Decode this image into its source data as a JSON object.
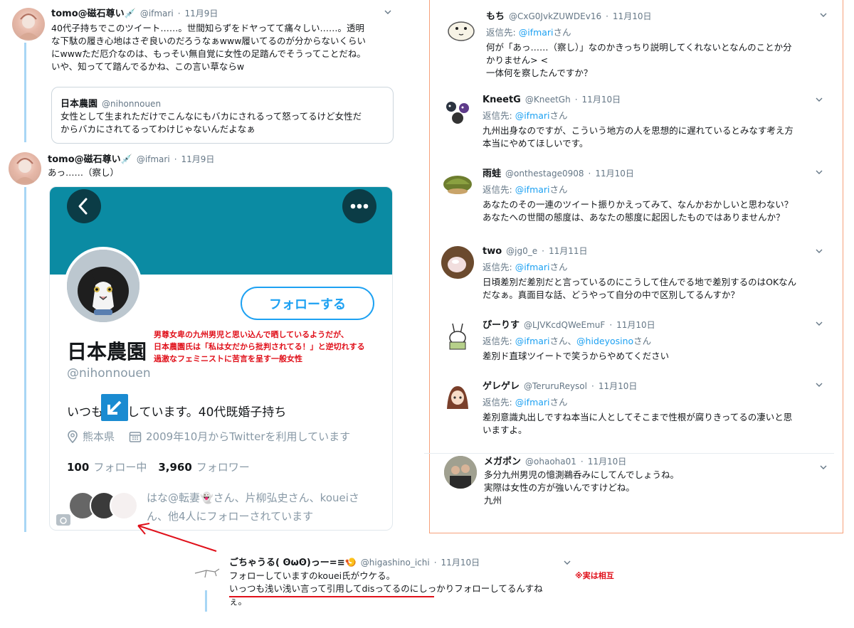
{
  "left_tweets": [
    {
      "name": "tomo@磁石尊い💉",
      "handle": "@ifmari",
      "date": "11月9日",
      "lines": [
        "40代子持ちでこのツイート……。世間知らずをドヤってて痛々しい……。透明",
        "な下駄の履き心地はさぞ良いのだろうなぁwww履いてるのが分からないくらい",
        "にwwwただ厄介なのは、もっそい無自覚に女性の足踏んでそうってことだね。",
        "いや、知ってて踏んでるかね、この言い草ならw"
      ],
      "quote": {
        "name": "日本農園",
        "handle": "@nihonnouen",
        "lines": [
          "女性として生まれただけでこんなにもバカにされるって怒ってるけど女性だ",
          "からバカにされてるってわけじゃないんだよなぁ"
        ]
      }
    },
    {
      "name": "tomo@磁石尊い💉",
      "handle": "@ifmari",
      "date": "11月9日",
      "text": "あっ……（察し）"
    }
  ],
  "profile_card": {
    "follow_button": "フォローする",
    "display_name": "日本農園",
    "handle": "@nihonnouen",
    "bio": "いつも感謝しています。40代既婚子持ち",
    "location": "熊本県",
    "joined": "2009年10月からTwitterを利用しています",
    "following_count": "100",
    "following_label": "フォロー中",
    "followers_count": "3,960",
    "followers_label": "フォロワー",
    "followed_by_line1": "はな@転妻👻さん、片柳弘史さん、koueiさ",
    "followed_by_line2": "ん、他4人にフォローされています",
    "back_icon": "chevron-left-icon",
    "more_icon": "more-icon",
    "banner_color": "#0b8ba3",
    "follow_color": "#1da1f2"
  },
  "annotation_red": {
    "lines": [
      "男尊女卑の九州男児と思い込んで晒しているようだが、",
      "日本農園氏は「私は女だから批判されてる！」と逆切れする",
      "過激なフェミニストに苦言を呈す一般女性"
    ],
    "color": "#e0101a"
  },
  "replies": [
    {
      "name": "もち",
      "handle": "@CxG0JvkZUWDEv16",
      "date": "11月10日",
      "reply_prefix": "返信先:",
      "reply_links": [
        "@ifmari"
      ],
      "reply_suffix": "さん",
      "lines": [
        "何が「あっ……（察し）」なのかきっちり説明してくれないとなんのことか分",
        "かりません> <",
        "一体何を察したんですか？"
      ]
    },
    {
      "name": "KneetG",
      "handle": "@KneetGh",
      "date": "11月10日",
      "reply_prefix": "返信先:",
      "reply_links": [
        "@ifmari"
      ],
      "reply_suffix": "さん",
      "lines": [
        "九州出身なのですが、こういう地方の人を思想的に遅れているとみなす考え方",
        "本当にやめてほしいです。"
      ]
    },
    {
      "name": "雨蛙",
      "handle": "@onthestage0908",
      "date": "11月10日",
      "reply_prefix": "返信先:",
      "reply_links": [
        "@ifmari"
      ],
      "reply_suffix": "さん",
      "lines": [
        "あなたのその一連のツイート振りかえってみて、なんかおかしいと思わない？",
        "あなたへの世間の態度は、あなたの態度に起因したものではありませんか？"
      ]
    },
    {
      "name": "two",
      "handle": "@jg0_e",
      "date": "11月11日",
      "reply_prefix": "返信先:",
      "reply_links": [
        "@ifmari"
      ],
      "reply_suffix": "さん",
      "lines": [
        "日頃差別だ差別だと言っているのにこうして住んでる地で差別するのはOKなん",
        "だなぁ。真面目な話、どうやって自分の中で区別してるんすか？"
      ]
    },
    {
      "name": "ぴーりす",
      "handle": "@LJVKcdQWeEmuF",
      "date": "11月10日",
      "reply_prefix": "返信先:",
      "reply_links": [
        "@ifmari",
        "@hideyosino"
      ],
      "reply_mid": "さん、",
      "reply_suffix": "さん",
      "lines": [
        "差別ド直球ツイートで笑うからやめてください"
      ]
    },
    {
      "name": "ゲレゲレ",
      "handle": "@TeruruReysol",
      "date": "11月10日",
      "reply_prefix": "返信先:",
      "reply_links": [
        "@ifmari"
      ],
      "reply_suffix": "さん",
      "lines": [
        "差別意識丸出しですね本当に人としてそこまで性根が腐りきってるの凄いと思",
        "いますよ。"
      ]
    },
    {
      "name": "メガポン",
      "handle": "@ohaoha01",
      "date": "11月10日",
      "lines": [
        "多分九州男児の憶測鵜呑みにしてんでしょうね。",
        "実際は女性の方が強いんですけどね。",
        "九州"
      ]
    }
  ],
  "bottom_tweet": {
    "name": "ごちゃうる( ʘωʘ)っー=≡🍤",
    "handle": "@higashino_ichi",
    "date": "11月10日",
    "lines": [
      "フォローしていますのkouei氏がウケる。",
      "いっつも浅い浅い言って引用してdisってるのにしっかりフォローしてるんすね",
      "ぇ。"
    ],
    "note": "※実は相互"
  },
  "colors": {
    "link": "#1da1f2",
    "accent_box": "#f6a07a",
    "thread": "#a8d6f5",
    "red": "#e0101a"
  }
}
